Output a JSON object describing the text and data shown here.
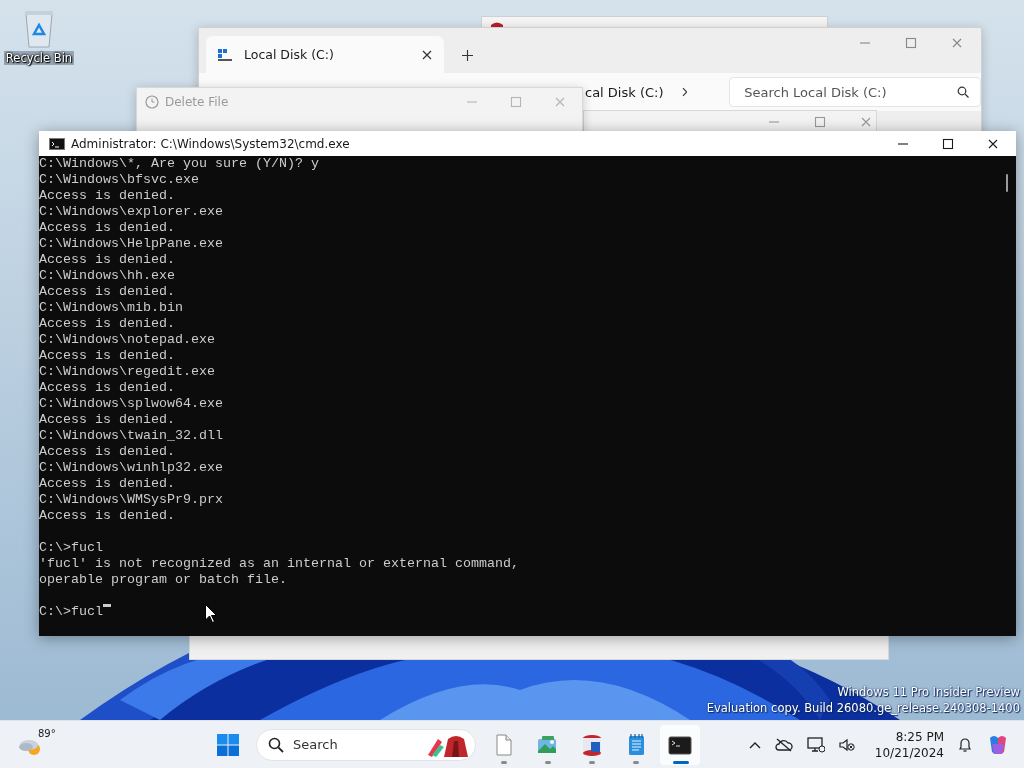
{
  "desktop": {
    "icons": [
      {
        "label": "Recycle Bin"
      }
    ],
    "watermark": [
      "Windows 11 Pro Insider Preview",
      "Evaluation copy. Build 26080.ge_release.240308-1400"
    ]
  },
  "explorer": {
    "tab": "Local Disk (C:)",
    "breadcrumb": "cal Disk (C:)",
    "search": {
      "placeholder": "Search Local Disk (C:)"
    }
  },
  "delete_dialog": {
    "title": "Delete File",
    "active": false
  },
  "console": {
    "title": "Administrator: C:\\Windows\\System32\\cmd.exe",
    "active": true,
    "cursor": true,
    "blocks": [
      [
        "C:\\Windows\\*, Are you sure (Y/N)? y",
        "C:\\Windows\\bfsvc.exe",
        "Access is denied.",
        "C:\\Windows\\explorer.exe",
        "Access is denied.",
        "C:\\Windows\\HelpPane.exe",
        "Access is denied.",
        "C:\\Windows\\hh.exe",
        "Access is denied.",
        "C:\\Windows\\mib.bin",
        "Access is denied.",
        "C:\\Windows\\notepad.exe",
        "Access is denied.",
        "C:\\Windows\\regedit.exe",
        "Access is denied.",
        "C:\\Windows\\splwow64.exe",
        "Access is denied.",
        "C:\\Windows\\twain_32.dll",
        "Access is denied.",
        "C:\\Windows\\winhlp32.exe",
        "Access is denied.",
        "C:\\Windows\\WMSysPr9.prx",
        "Access is denied."
      ],
      [
        "C:\\>fucl",
        "'fucl' is not recognized as an internal or external command,",
        "operable program or batch file."
      ],
      [
        "C:\\>fucl"
      ]
    ]
  },
  "taskbar": {
    "weather": "89°",
    "search": {
      "placeholder": "Search"
    },
    "apps": [
      {
        "kind": "file",
        "selected": false
      },
      {
        "kind": "photos",
        "selected": false
      },
      {
        "kind": "database",
        "selected": false
      },
      {
        "kind": "notepad",
        "selected": false
      },
      {
        "kind": "terminal",
        "selected": true
      }
    ],
    "time": "8:25 PM",
    "date": "10/21/2024"
  }
}
